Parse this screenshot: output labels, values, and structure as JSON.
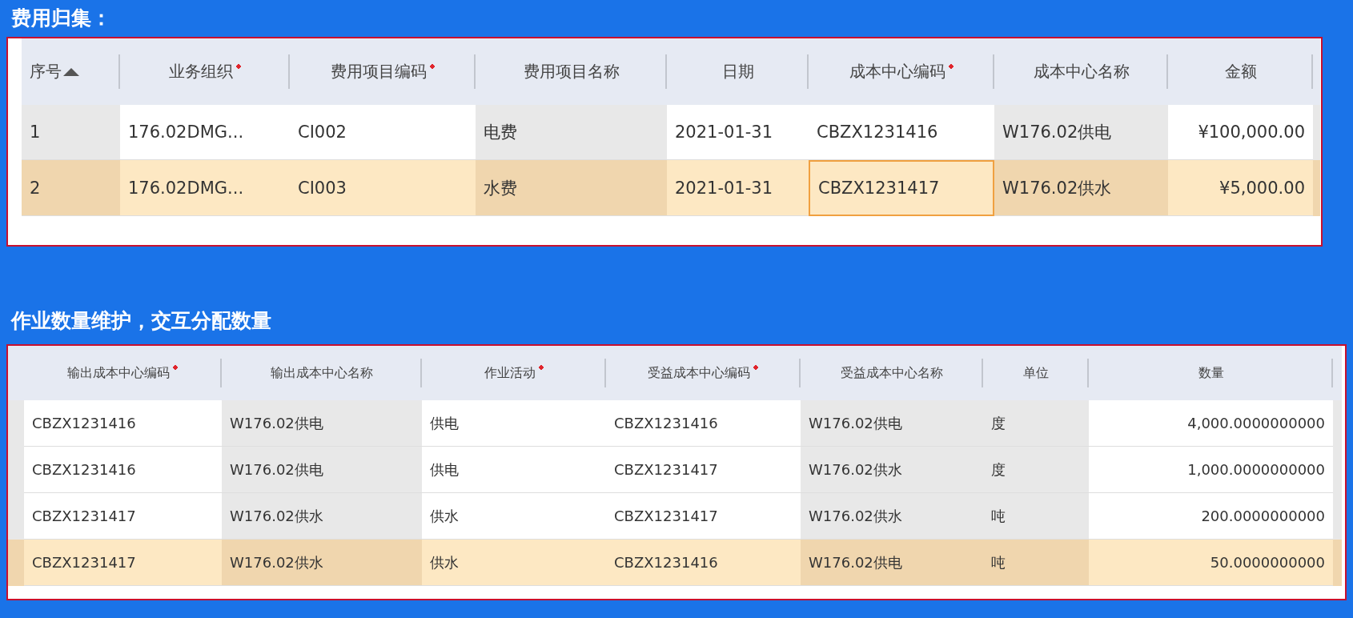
{
  "sections": [
    {
      "title": "费用归集：",
      "kind": "cost",
      "columns": [
        {
          "label": "序号",
          "required": false,
          "sorted": true,
          "shaded": true,
          "kind": "text"
        },
        {
          "label": "业务组织",
          "required": true,
          "shaded": false,
          "kind": "text"
        },
        {
          "label": "费用项目编码",
          "required": true,
          "shaded": false,
          "kind": "text"
        },
        {
          "label": "费用项目名称",
          "required": false,
          "shaded": true,
          "kind": "text"
        },
        {
          "label": "日期",
          "required": false,
          "shaded": false,
          "kind": "text"
        },
        {
          "label": "成本中心编码",
          "required": true,
          "shaded": false,
          "kind": "text"
        },
        {
          "label": "成本中心名称",
          "required": false,
          "shaded": true,
          "kind": "text"
        },
        {
          "label": "金额",
          "required": false,
          "shaded": false,
          "kind": "number"
        }
      ],
      "rows": [
        {
          "selected": false,
          "cells": [
            {
              "text": "1",
              "focused": false
            },
            {
              "text": "176.02DMG...",
              "focused": false
            },
            {
              "text": "CI002",
              "focused": false
            },
            {
              "text": "电费",
              "focused": false
            },
            {
              "text": "2021-01-31",
              "focused": false
            },
            {
              "text": "CBZX1231416",
              "focused": false
            },
            {
              "text": "W176.02供电",
              "focused": false
            },
            {
              "text": "¥100,000.00",
              "focused": false
            }
          ]
        },
        {
          "selected": true,
          "cells": [
            {
              "text": "2",
              "focused": false
            },
            {
              "text": "176.02DMG...",
              "focused": false
            },
            {
              "text": "CI003",
              "focused": false
            },
            {
              "text": "水费",
              "focused": false
            },
            {
              "text": "2021-01-31",
              "focused": false
            },
            {
              "text": "CBZX1231417",
              "focused": true
            },
            {
              "text": "W176.02供水",
              "focused": false
            },
            {
              "text": "¥5,000.00",
              "focused": false
            }
          ]
        }
      ]
    },
    {
      "title": "作业数量维护，交互分配数量",
      "kind": "qty",
      "columns": [
        {
          "label": "输出成本中心编码",
          "required": true,
          "shaded": false,
          "kind": "text"
        },
        {
          "label": "输出成本中心名称",
          "required": false,
          "shaded": true,
          "kind": "text"
        },
        {
          "label": "作业活动",
          "required": true,
          "shaded": false,
          "kind": "text"
        },
        {
          "label": "受益成本中心编码",
          "required": true,
          "shaded": false,
          "kind": "text"
        },
        {
          "label": "受益成本中心名称",
          "required": false,
          "shaded": true,
          "kind": "text"
        },
        {
          "label": "单位",
          "required": false,
          "shaded": true,
          "kind": "text"
        },
        {
          "label": "数量",
          "required": false,
          "shaded": false,
          "kind": "number"
        }
      ],
      "rows": [
        {
          "selected": false,
          "cells": [
            {
              "text": "CBZX1231416",
              "focused": false
            },
            {
              "text": "W176.02供电",
              "focused": false
            },
            {
              "text": "供电",
              "focused": false
            },
            {
              "text": "CBZX1231416",
              "focused": false
            },
            {
              "text": "W176.02供电",
              "focused": false
            },
            {
              "text": "度",
              "focused": false
            },
            {
              "text": "4,000.0000000000",
              "focused": false
            }
          ]
        },
        {
          "selected": false,
          "cells": [
            {
              "text": "CBZX1231416",
              "focused": false
            },
            {
              "text": "W176.02供电",
              "focused": false
            },
            {
              "text": "供电",
              "focused": false
            },
            {
              "text": "CBZX1231417",
              "focused": false
            },
            {
              "text": "W176.02供水",
              "focused": false
            },
            {
              "text": "度",
              "focused": false
            },
            {
              "text": "1,000.0000000000",
              "focused": false
            }
          ]
        },
        {
          "selected": false,
          "cells": [
            {
              "text": "CBZX1231417",
              "focused": false
            },
            {
              "text": "W176.02供水",
              "focused": false
            },
            {
              "text": "供水",
              "focused": false
            },
            {
              "text": "CBZX1231417",
              "focused": false
            },
            {
              "text": "W176.02供水",
              "focused": false
            },
            {
              "text": "吨",
              "focused": false
            },
            {
              "text": "200.0000000000",
              "focused": false
            }
          ]
        },
        {
          "selected": true,
          "cells": [
            {
              "text": "CBZX1231417",
              "focused": false
            },
            {
              "text": "W176.02供水",
              "focused": false
            },
            {
              "text": "供水",
              "focused": false
            },
            {
              "text": "CBZX1231416",
              "focused": false
            },
            {
              "text": "W176.02供电",
              "focused": false
            },
            {
              "text": "吨",
              "focused": false
            },
            {
              "text": "50.0000000000",
              "focused": false
            }
          ]
        }
      ]
    }
  ]
}
